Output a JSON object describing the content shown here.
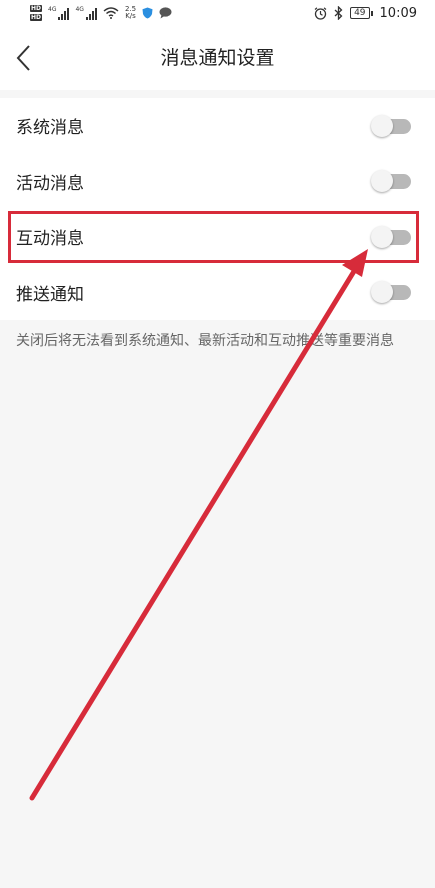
{
  "status_bar": {
    "hd_label": "HD",
    "sim1_gen": "4G",
    "sim2_gen": "4G",
    "net_speed_value": "2.5",
    "net_speed_unit": "K/s",
    "battery": "49",
    "time": "10:09"
  },
  "header": {
    "title": "消息通知设置"
  },
  "settings": [
    {
      "label": "系统消息",
      "enabled": false
    },
    {
      "label": "活动消息",
      "enabled": false
    },
    {
      "label": "互动消息",
      "enabled": false
    },
    {
      "label": "推送通知",
      "enabled": false
    }
  ],
  "note": "关闭后将无法看到系统通知、最新活动和互动推送等重要消息",
  "colors": {
    "annotation": "#d72b3a",
    "toggle_off_track": "#b8b8b8",
    "toggle_knob": "#f4f4f4",
    "page_background": "#f6f6f6"
  },
  "icons": {
    "back": "chevron-left-icon",
    "wifi": "wifi-icon",
    "shield": "shield-icon",
    "chat": "chat-bubble-icon",
    "alarm": "alarm-icon",
    "bluetooth": "bluetooth-icon"
  }
}
